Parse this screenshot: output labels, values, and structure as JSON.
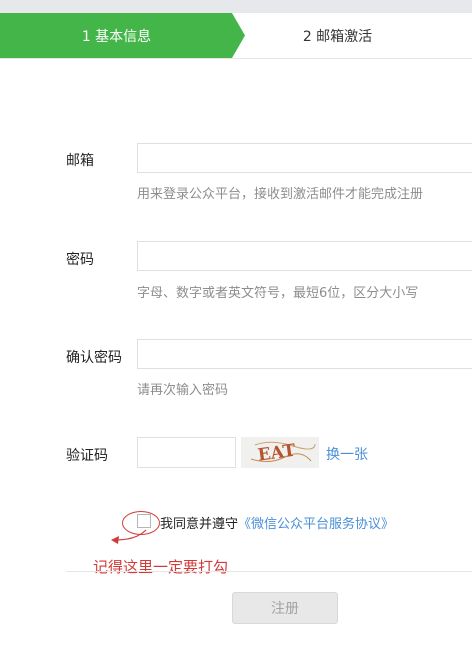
{
  "steps": {
    "step1": "1 基本信息",
    "step2": "2 邮箱激活",
    "accent_color": "#44b549"
  },
  "form": {
    "email": {
      "label": "邮箱",
      "value": "",
      "hint": "用来登录公众平台，接收到激活邮件才能完成注册"
    },
    "password": {
      "label": "密码",
      "value": "",
      "hint": "字母、数字或者英文符号，最短6位，区分大小写"
    },
    "confirm_password": {
      "label": "确认密码",
      "value": "",
      "hint": "请再次输入密码"
    },
    "captcha": {
      "label": "验证码",
      "value": "",
      "image_text": "EAT",
      "refresh_label": "换一张"
    }
  },
  "agreement": {
    "checked": false,
    "prefix": "我同意并遵守",
    "link": "《微信公众平台服务协议》"
  },
  "annotation": {
    "text": "记得这里一定要打勾",
    "color": "#d23a3a"
  },
  "submit": {
    "label": "注册",
    "disabled": true
  }
}
